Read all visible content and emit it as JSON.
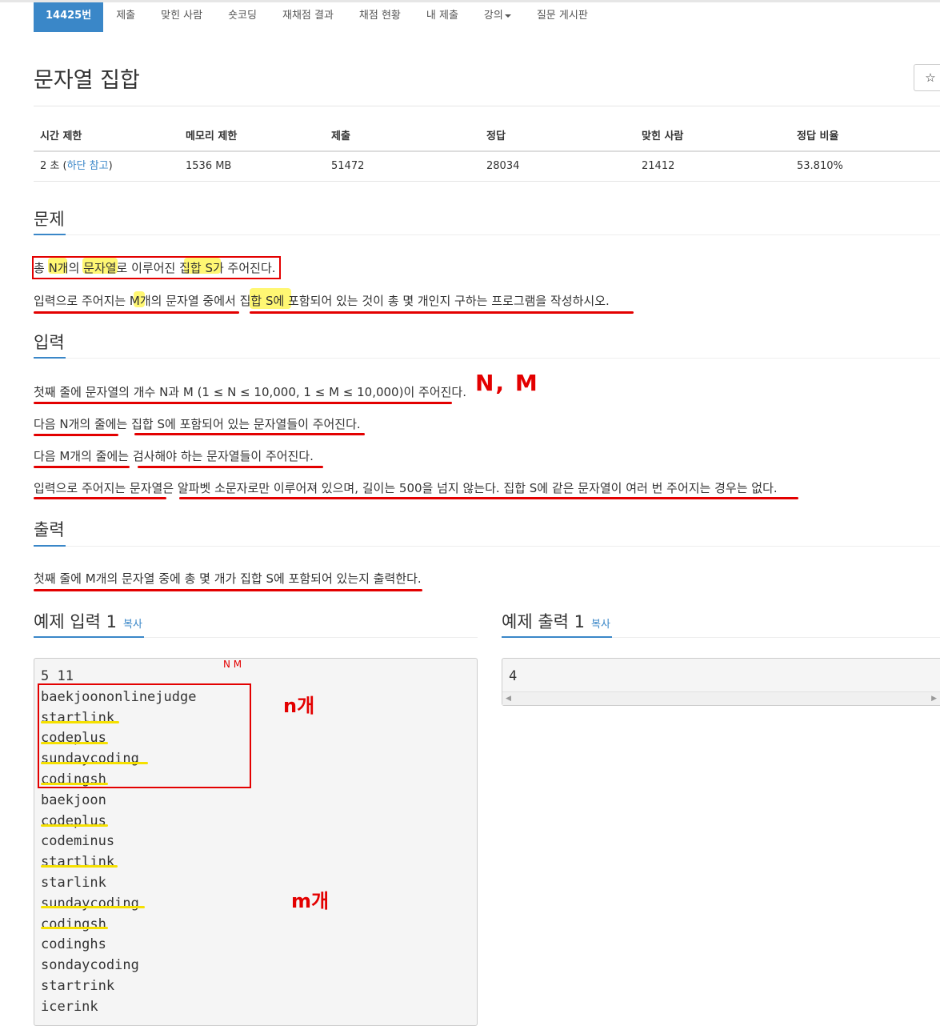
{
  "nav": {
    "items": [
      {
        "label": "14425번",
        "active": true
      },
      {
        "label": "제출"
      },
      {
        "label": "맞힌 사람"
      },
      {
        "label": "숏코딩"
      },
      {
        "label": "재채점 결과"
      },
      {
        "label": "채점 현황"
      },
      {
        "label": "내 제출"
      },
      {
        "label": "강의"
      },
      {
        "label": "질문 게시판"
      }
    ]
  },
  "title": "문자열 집합",
  "star_icon": "☆",
  "info": {
    "headers": [
      "시간 제한",
      "메모리 제한",
      "제출",
      "정답",
      "맞힌 사람",
      "정답 비율"
    ],
    "time_value": "2 초 (",
    "time_link": "하단 참고",
    "time_close": ")",
    "memory": "1536 MB",
    "submissions": "51472",
    "accepted": "28034",
    "solved": "21412",
    "ratio": "53.810%"
  },
  "problem": {
    "heading": "문제",
    "lines": [
      "총 N개의 문자열로 이루어진 집합 S가 주어진다.",
      "입력으로 주어지는 M개의 문자열 중에서 집합 S에 포함되어 있는 것이 총 몇 개인지 구하는 프로그램을 작성하시오."
    ]
  },
  "input": {
    "heading": "입력",
    "lines": [
      "첫째 줄에 문자열의 개수 N과 M (1 ≤ N ≤ 10,000, 1 ≤ M ≤ 10,000)이 주어진다.",
      "다음 N개의 줄에는 집합 S에 포함되어 있는 문자열들이 주어진다.",
      "다음 M개의 줄에는 검사해야 하는 문자열들이 주어진다.",
      "입력으로 주어지는 문자열은 알파벳 소문자로만 이루어져 있으며, 길이는 500을 넘지 않는다. 집합 S에 같은 문자열이 여러 번 주어지는 경우는 없다."
    ]
  },
  "output": {
    "heading": "출력",
    "lines": [
      "첫째 줄에 M개의 문자열 중에 총 몇 개가 집합 S에 포함되어 있는지 출력한다."
    ]
  },
  "sample_input": {
    "heading": "예제 입력 1",
    "copy": "복사",
    "text": "5 11\nbaekjoononlinejudge\nstartlink\ncodeplus\nsundaycoding\ncodingsh\nbaekjoon\ncodeplus\ncodeminus\nstartlink\nstarlink\nsundaycoding\ncodingsh\ncodinghs\nsondaycoding\nstartrink\nicerink"
  },
  "sample_output": {
    "heading": "예제 출력 1",
    "copy": "복사",
    "text": "4"
  },
  "annotations": {
    "nm_top": "N, M",
    "nm_small": "N M",
    "n_count": "n개",
    "m_count": "m개"
  },
  "colors": {
    "accent": "#3a87c8",
    "annotation_red": "#e30000",
    "highlight_yellow": "#fff000"
  }
}
